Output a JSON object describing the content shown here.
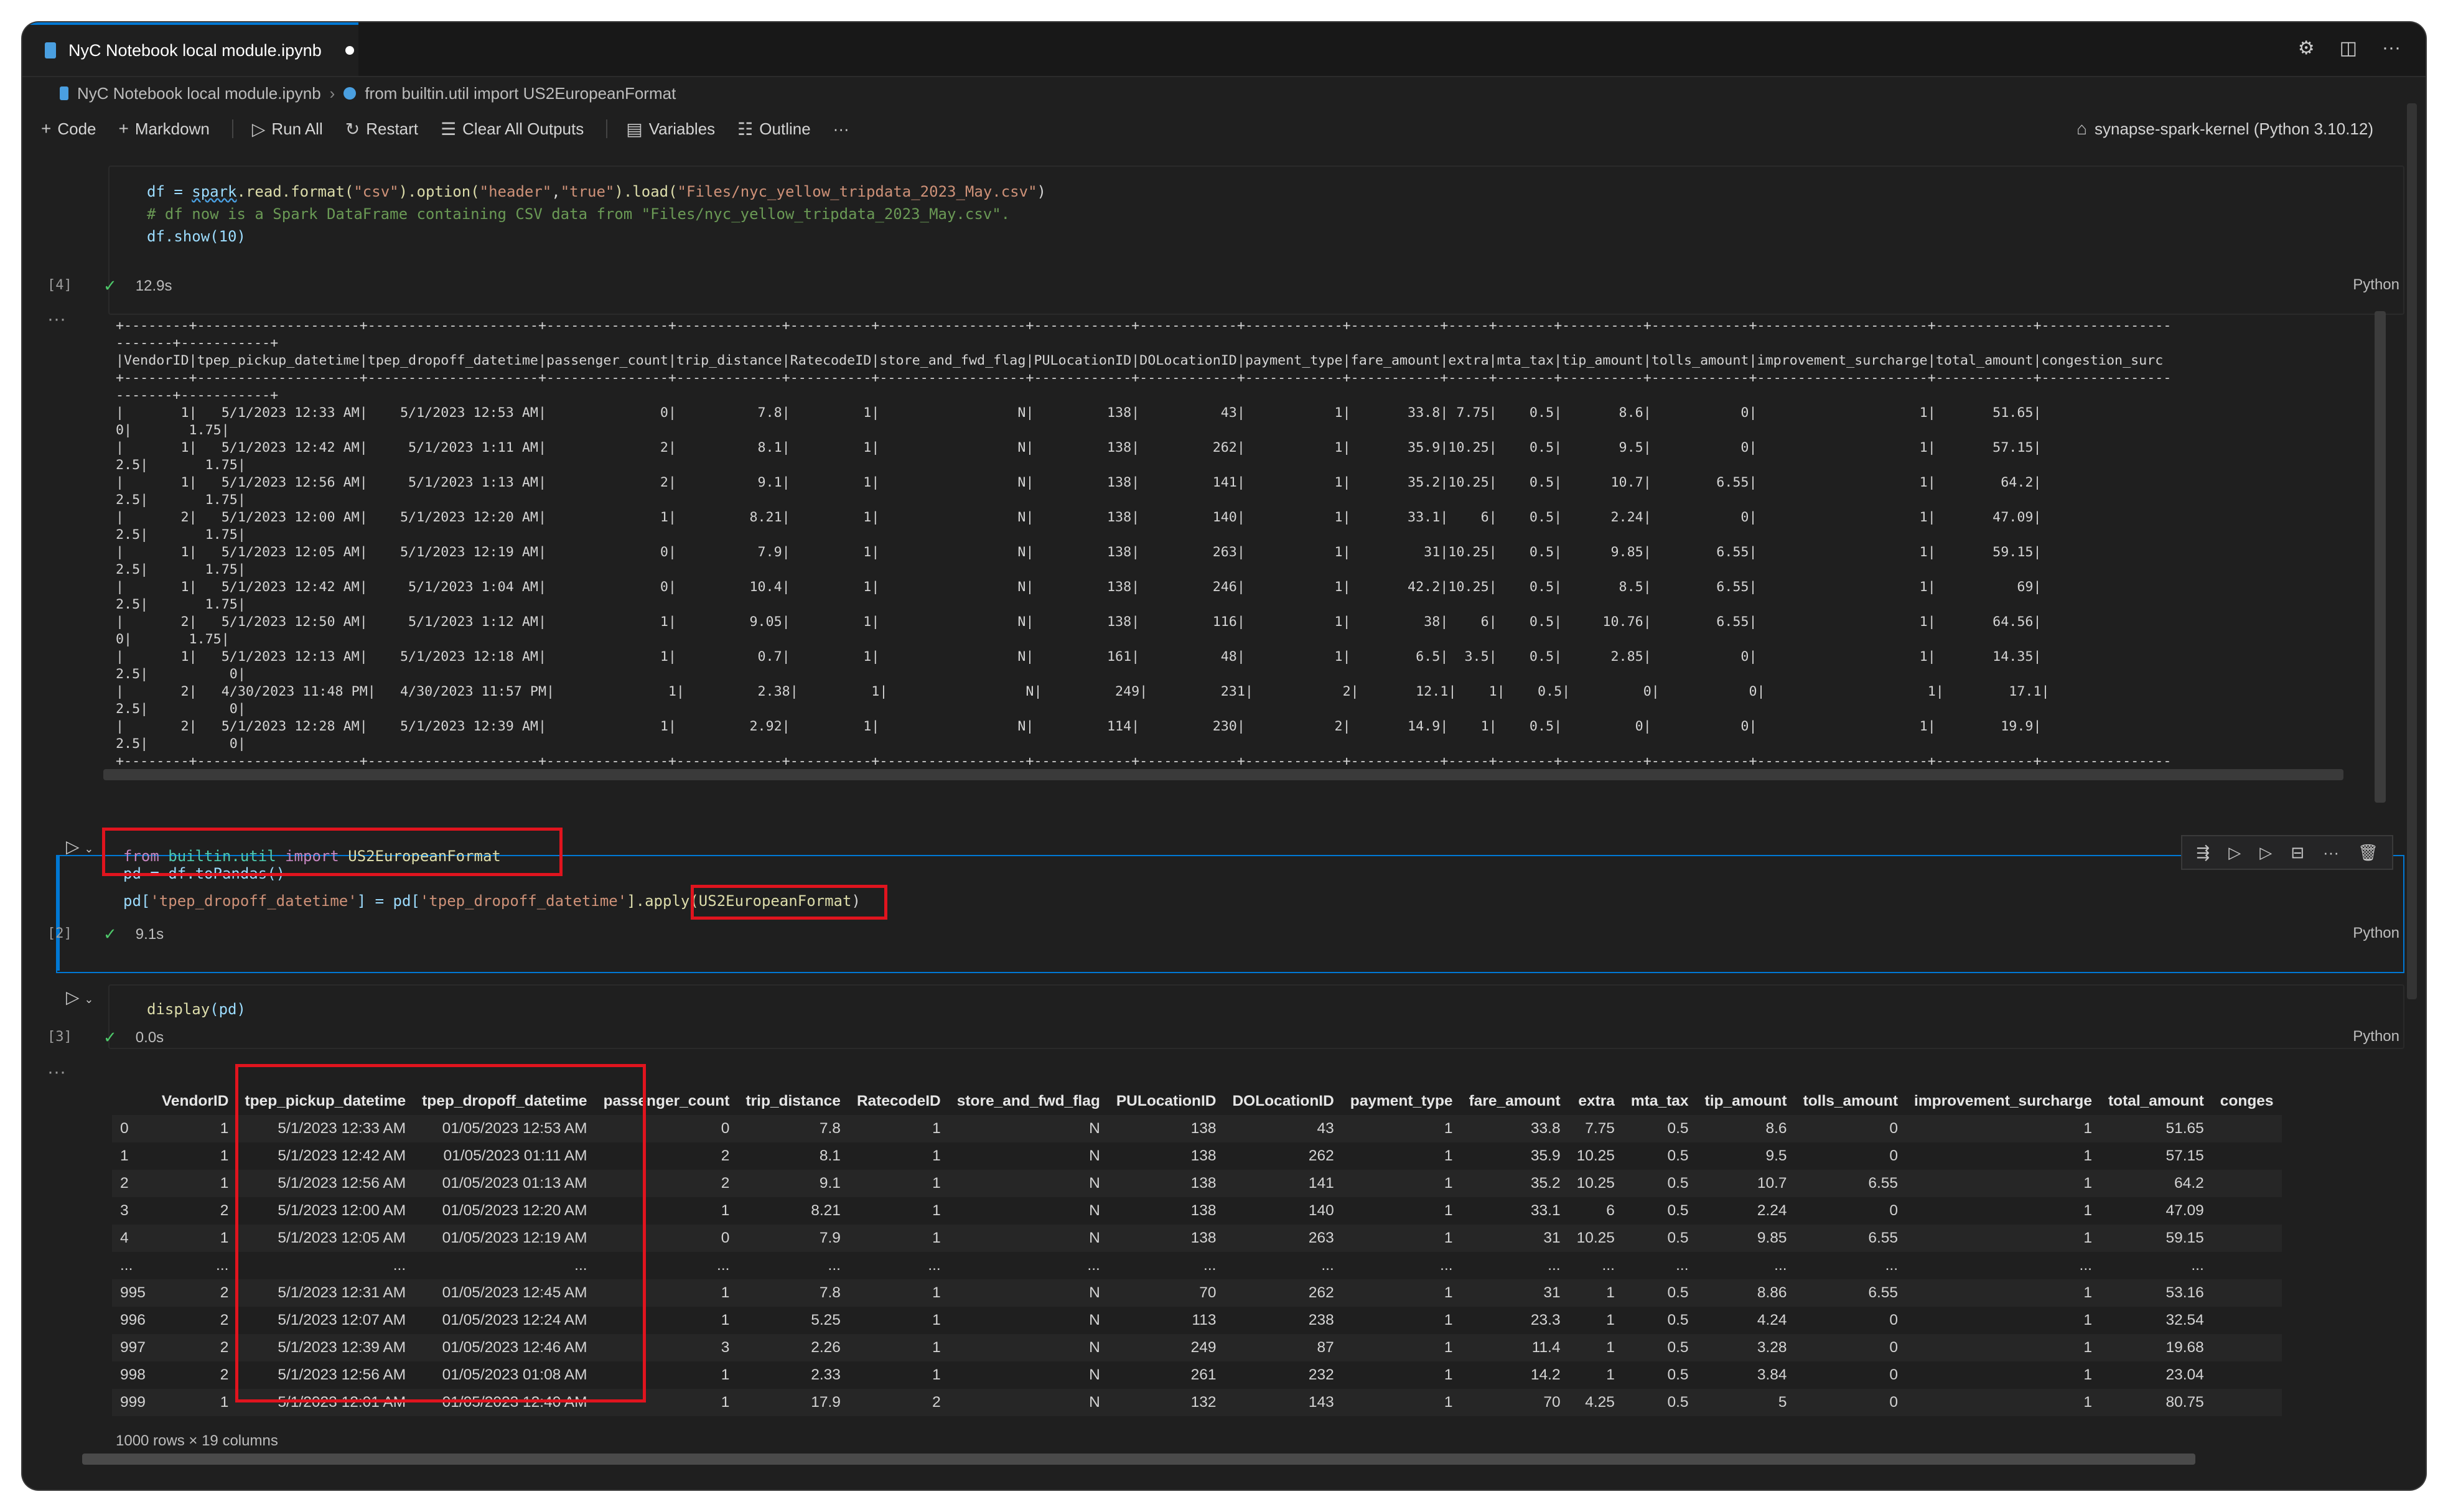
{
  "tab": {
    "title": "NyC Notebook local module.ipynb"
  },
  "breadcrumb": {
    "file": "NyC Notebook local module.ipynb",
    "cell": "from builtin.util import US2EuropeanFormat"
  },
  "toolbar": {
    "code": "Code",
    "markdown": "Markdown",
    "run_all": "Run All",
    "restart": "Restart",
    "clear_outputs": "Clear All Outputs",
    "variables": "Variables",
    "outline": "Outline",
    "more": "···",
    "kernel": "synapse-spark-kernel (Python 3.10.12)"
  },
  "cell1": {
    "exec": "[4]",
    "time": "12.9s",
    "lang": "Python",
    "line1": {
      "a": "df = ",
      "b": "spark",
      "c": ".read.format(",
      "d": "\"csv\"",
      "e": ").option(",
      "f": "\"header\"",
      "g": ",",
      "h": "\"true\"",
      "i": ").load(",
      "j": "\"Files/nyc_yellow_tripdata_2023_May.csv\"",
      "k": ")"
    },
    "line2": "# df now is a Spark DataFrame containing CSV data from \"Files/nyc_yellow_tripdata_2023_May.csv\".",
    "line3": "df.show(10)",
    "output": "+--------+--------------------+---------------------+---------------+-------------+----------+------------------+------------+------------+------------+-----------+-----+-------+----------+------------+---------------------+------------+----------------\n-------+-----------+\n|VendorID|tpep_pickup_datetime|tpep_dropoff_datetime|passenger_count|trip_distance|RatecodeID|store_and_fwd_flag|PULocationID|DOLocationID|payment_type|fare_amount|extra|mta_tax|tip_amount|tolls_amount|improvement_surcharge|total_amount|congestion_surc\n+--------+--------------------+---------------------+---------------+-------------+----------+------------------+------------+------------+------------+-----------+-----+-------+----------+------------+---------------------+------------+----------------\n-------+-----------+\n|       1|   5/1/2023 12:33 AM|    5/1/2023 12:53 AM|              0|          7.8|         1|                 N|         138|          43|           1|       33.8| 7.75|    0.5|       8.6|           0|                    1|       51.65|\n0|       1.75|\n|       1|   5/1/2023 12:42 AM|     5/1/2023 1:11 AM|              2|          8.1|         1|                 N|         138|         262|           1|       35.9|10.25|    0.5|       9.5|           0|                    1|       57.15|\n2.5|       1.75|\n|       1|   5/1/2023 12:56 AM|     5/1/2023 1:13 AM|              2|          9.1|         1|                 N|         138|         141|           1|       35.2|10.25|    0.5|      10.7|        6.55|                    1|        64.2|\n2.5|       1.75|\n|       2|   5/1/2023 12:00 AM|    5/1/2023 12:20 AM|              1|         8.21|         1|                 N|         138|         140|           1|       33.1|    6|    0.5|      2.24|           0|                    1|       47.09|\n2.5|       1.75|\n|       1|   5/1/2023 12:05 AM|    5/1/2023 12:19 AM|              0|          7.9|         1|                 N|         138|         263|           1|         31|10.25|    0.5|      9.85|        6.55|                    1|       59.15|\n2.5|       1.75|\n|       1|   5/1/2023 12:42 AM|     5/1/2023 1:04 AM|              0|         10.4|         1|                 N|         138|         246|           1|       42.2|10.25|    0.5|       8.5|        6.55|                    1|          69|\n2.5|       1.75|\n|       2|   5/1/2023 12:50 AM|     5/1/2023 1:12 AM|              1|         9.05|         1|                 N|         138|         116|           1|         38|    6|    0.5|     10.76|        6.55|                    1|       64.56|\n0|       1.75|\n|       1|   5/1/2023 12:13 AM|    5/1/2023 12:18 AM|              1|          0.7|         1|                 N|         161|          48|           1|        6.5|  3.5|    0.5|      2.85|           0|                    1|       14.35|\n2.5|          0|\n|       2|   4/30/2023 11:48 PM|   4/30/2023 11:57 PM|              1|         2.38|         1|                 N|         249|         231|           2|       12.1|    1|    0.5|         0|           0|                    1|        17.1|\n2.5|          0|\n|       2|   5/1/2023 12:28 AM|    5/1/2023 12:39 AM|              1|         2.92|         1|                 N|         114|         230|           2|       14.9|    1|    0.5|         0|           0|                    1|        19.9|\n2.5|          0|\n+--------+--------------------+---------------------+---------------+-------------+----------+------------------+------------+------------+------------+-----------+-----+-------+----------+------------+---------------------+------------+----------------"
  },
  "cell2": {
    "exec": "[2]",
    "time": "9.1s",
    "lang": "Python",
    "l1": {
      "a": "from",
      "b": " builtin.util ",
      "c": "import",
      "d": " US2EuropeanFormat"
    },
    "l2": "pd = df.toPandas()",
    "l3": {
      "a": "pd[",
      "b": "'tpep_dropoff_datetime'",
      "c": "] = pd[",
      "d": "'tpep_dropoff_datetime'",
      "e": "].apply(",
      "f": "US2EuropeanFormat",
      "g": ")"
    }
  },
  "cell3": {
    "exec": "[3]",
    "time": "0.0s",
    "lang": "Python",
    "l1": {
      "a": "display",
      "b": "(pd)"
    },
    "columns": [
      "",
      "VendorID",
      "tpep_pickup_datetime",
      "tpep_dropoff_datetime",
      "passenger_count",
      "trip_distance",
      "RatecodeID",
      "store_and_fwd_flag",
      "PULocationID",
      "DOLocationID",
      "payment_type",
      "fare_amount",
      "extra",
      "mta_tax",
      "tip_amount",
      "tolls_amount",
      "improvement_surcharge",
      "total_amount",
      "conges"
    ],
    "rows": [
      [
        "0",
        "1",
        "5/1/2023 12:33 AM",
        "01/05/2023 12:53 AM",
        "0",
        "7.8",
        "1",
        "N",
        "138",
        "43",
        "1",
        "33.8",
        "7.75",
        "0.5",
        "8.6",
        "0",
        "1",
        "51.65",
        ""
      ],
      [
        "1",
        "1",
        "5/1/2023 12:42 AM",
        "01/05/2023 01:11 AM",
        "2",
        "8.1",
        "1",
        "N",
        "138",
        "262",
        "1",
        "35.9",
        "10.25",
        "0.5",
        "9.5",
        "0",
        "1",
        "57.15",
        ""
      ],
      [
        "2",
        "1",
        "5/1/2023 12:56 AM",
        "01/05/2023 01:13 AM",
        "2",
        "9.1",
        "1",
        "N",
        "138",
        "141",
        "1",
        "35.2",
        "10.25",
        "0.5",
        "10.7",
        "6.55",
        "1",
        "64.2",
        ""
      ],
      [
        "3",
        "2",
        "5/1/2023 12:00 AM",
        "01/05/2023 12:20 AM",
        "1",
        "8.21",
        "1",
        "N",
        "138",
        "140",
        "1",
        "33.1",
        "6",
        "0.5",
        "2.24",
        "0",
        "1",
        "47.09",
        ""
      ],
      [
        "4",
        "1",
        "5/1/2023 12:05 AM",
        "01/05/2023 12:19 AM",
        "0",
        "7.9",
        "1",
        "N",
        "138",
        "263",
        "1",
        "31",
        "10.25",
        "0.5",
        "9.85",
        "6.55",
        "1",
        "59.15",
        ""
      ],
      [
        "...",
        "...",
        "...",
        "...",
        "...",
        "...",
        "...",
        "...",
        "...",
        "...",
        "...",
        "...",
        "...",
        "...",
        "...",
        "...",
        "...",
        "...",
        ""
      ],
      [
        "995",
        "2",
        "5/1/2023 12:31 AM",
        "01/05/2023 12:45 AM",
        "1",
        "7.8",
        "1",
        "N",
        "70",
        "262",
        "1",
        "31",
        "1",
        "0.5",
        "8.86",
        "6.55",
        "1",
        "53.16",
        ""
      ],
      [
        "996",
        "2",
        "5/1/2023 12:07 AM",
        "01/05/2023 12:24 AM",
        "1",
        "5.25",
        "1",
        "N",
        "113",
        "238",
        "1",
        "23.3",
        "1",
        "0.5",
        "4.24",
        "0",
        "1",
        "32.54",
        ""
      ],
      [
        "997",
        "2",
        "5/1/2023 12:39 AM",
        "01/05/2023 12:46 AM",
        "3",
        "2.26",
        "1",
        "N",
        "249",
        "87",
        "1",
        "11.4",
        "1",
        "0.5",
        "3.28",
        "0",
        "1",
        "19.68",
        ""
      ],
      [
        "998",
        "2",
        "5/1/2023 12:56 AM",
        "01/05/2023 01:08 AM",
        "1",
        "2.33",
        "1",
        "N",
        "261",
        "232",
        "1",
        "14.2",
        "1",
        "0.5",
        "3.84",
        "0",
        "1",
        "23.04",
        ""
      ],
      [
        "999",
        "1",
        "5/1/2023 12:01 AM",
        "01/05/2023 12:40 AM",
        "1",
        "17.9",
        "2",
        "N",
        "132",
        "143",
        "1",
        "70",
        "4.25",
        "0.5",
        "5",
        "0",
        "1",
        "80.75",
        ""
      ]
    ],
    "info": "1000 rows × 19 columns"
  },
  "colors": {
    "accent": "#0078d4",
    "highlight": "#e0141e",
    "success": "#4ec96a"
  },
  "icons": [
    "notebook-icon",
    "gear-icon",
    "split-editor-icon",
    "more-icon",
    "plus-icon",
    "run-all-icon",
    "restart-icon",
    "clear-outputs-icon",
    "variables-icon",
    "outline-icon",
    "kernel-icon",
    "run-cell-icon",
    "check-icon",
    "delete-icon"
  ]
}
